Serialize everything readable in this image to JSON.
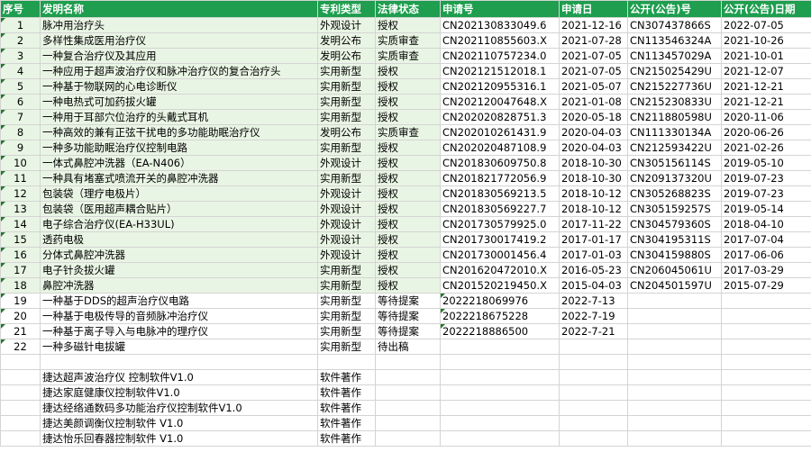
{
  "headers": [
    "序号",
    "发明名称",
    "专利类型",
    "法律状态",
    "申请号",
    "申请日",
    "公开(公告)号",
    "公开(公告)日期"
  ],
  "rows": [
    [
      "1",
      "脉冲用治疗头",
      "外观设计",
      "授权",
      "CN202130833049.6",
      "2021-12-16",
      "CN307437866S",
      "2022-07-05"
    ],
    [
      "2",
      "多样性集成医用治疗仪",
      "发明公布",
      "实质审查",
      "CN202110855603.X",
      "2021-07-28",
      "CN113546324A",
      "2021-10-26"
    ],
    [
      "3",
      "一种复合治疗仪及其应用",
      "发明公布",
      "实质审查",
      "CN202110757234.0",
      "2021-07-05",
      "CN113457029A",
      "2021-10-01"
    ],
    [
      "4",
      "一种应用于超声波治疗仪和脉冲治疗仪的复合治疗头",
      "实用新型",
      "授权",
      "CN202121512018.1",
      "2021-07-05",
      "CN215025429U",
      "2021-12-07"
    ],
    [
      "5",
      "一种基于物联网的心电诊断仪",
      "实用新型",
      "授权",
      "CN202120955316.1",
      "2021-05-07",
      "CN215227736U",
      "2021-12-21"
    ],
    [
      "6",
      "一种电热式可加药拔火罐",
      "实用新型",
      "授权",
      "CN202120047648.X",
      "2021-01-08",
      "CN215230833U",
      "2021-12-21"
    ],
    [
      "7",
      "一种用于耳部穴位治疗的头戴式耳机",
      "实用新型",
      "授权",
      "CN202020828751.3",
      "2020-05-18",
      "CN211880598U",
      "2020-11-06"
    ],
    [
      "8",
      "一种高效的兼有正弦干扰电的多功能助眠治疗仪",
      "发明公布",
      "实质审查",
      "CN202010261431.9",
      "2020-04-03",
      "CN111330134A",
      "2020-06-26"
    ],
    [
      "9",
      "一种多功能助眠治疗仪控制电路",
      "实用新型",
      "授权",
      "CN202020487108.9",
      "2020-04-03",
      "CN212593422U",
      "2021-02-26"
    ],
    [
      "10",
      "一体式鼻腔冲洗器（EA-N406）",
      "外观设计",
      "授权",
      "CN201830609750.8",
      "2018-10-30",
      "CN305156114S",
      "2019-05-10"
    ],
    [
      "11",
      "一种具有堵塞式喷流开关的鼻腔冲洗器",
      "实用新型",
      "授权",
      "CN201821772056.9",
      "2018-10-30",
      "CN209137320U",
      "2019-07-23"
    ],
    [
      "12",
      "包装袋（理疗电极片）",
      "外观设计",
      "授权",
      "CN201830569213.5",
      "2018-10-12",
      "CN305268823S",
      "2019-07-23"
    ],
    [
      "13",
      "包装袋（医用超声耦合贴片）",
      "外观设计",
      "授权",
      "CN201830569227.7",
      "2018-10-12",
      "CN305159257S",
      "2019-05-14"
    ],
    [
      "14",
      "电子综合治疗仪(EA-H33UL)",
      "外观设计",
      "授权",
      "CN201730579925.0",
      "2017-11-22",
      "CN304579360S",
      "2018-04-10"
    ],
    [
      "15",
      "透药电极",
      "外观设计",
      "授权",
      "CN201730017419.2",
      "2017-01-17",
      "CN304195311S",
      "2017-07-04"
    ],
    [
      "16",
      "分体式鼻腔冲洗器",
      "外观设计",
      "授权",
      "CN201730001456.4",
      "2017-01-03",
      "CN304159880S",
      "2017-06-06"
    ],
    [
      "17",
      "电子针灸拔火罐",
      "实用新型",
      "授权",
      "CN201620472010.X",
      "2016-05-23",
      "CN206045061U",
      "2017-03-29"
    ],
    [
      "18",
      "鼻腔冲洗器",
      "实用新型",
      "授权",
      "CN201520219450.X",
      "2015-04-03",
      "CN204501597U",
      "2015-07-29"
    ],
    [
      "19",
      "一种基于DDS的超声治疗仪电路",
      "实用新型",
      "等待提案",
      "2022218069976",
      "2022-7-13",
      "",
      ""
    ],
    [
      "20",
      "一种基于电极传导的音频脉冲治疗仪",
      "实用新型",
      "等待提案",
      "2022218675228",
      "2022-7-19",
      "",
      ""
    ],
    [
      "21",
      "一种基于离子导入与电脉冲的理疗仪",
      "实用新型",
      "等待提案",
      "2022218886500",
      "2022-7-21",
      "",
      ""
    ],
    [
      "22",
      "一种多磁针电拔罐",
      "实用新型",
      "待出稿",
      "",
      "",
      "",
      ""
    ],
    [
      "",
      "",
      "",
      "",
      "",
      "",
      "",
      ""
    ],
    [
      "",
      "捷达超声波治疗仪 控制软件V1.0",
      "软件著作",
      "",
      "",
      "",
      "",
      ""
    ],
    [
      "",
      "捷达家庭健康仪控制软件V1.0",
      "软件著作",
      "",
      "",
      "",
      "",
      ""
    ],
    [
      "",
      "捷达经络通数码多功能治疗仪控制软件V1.0",
      "软件著作",
      "",
      "",
      "",
      "",
      ""
    ],
    [
      "",
      "捷达美颜调衡仪控制软件  V1.0",
      "软件著作",
      "",
      "",
      "",
      "",
      ""
    ],
    [
      "",
      "捷达怡乐回春器控制软件 V1.0",
      "软件著作",
      "",
      "",
      "",
      "",
      ""
    ]
  ]
}
